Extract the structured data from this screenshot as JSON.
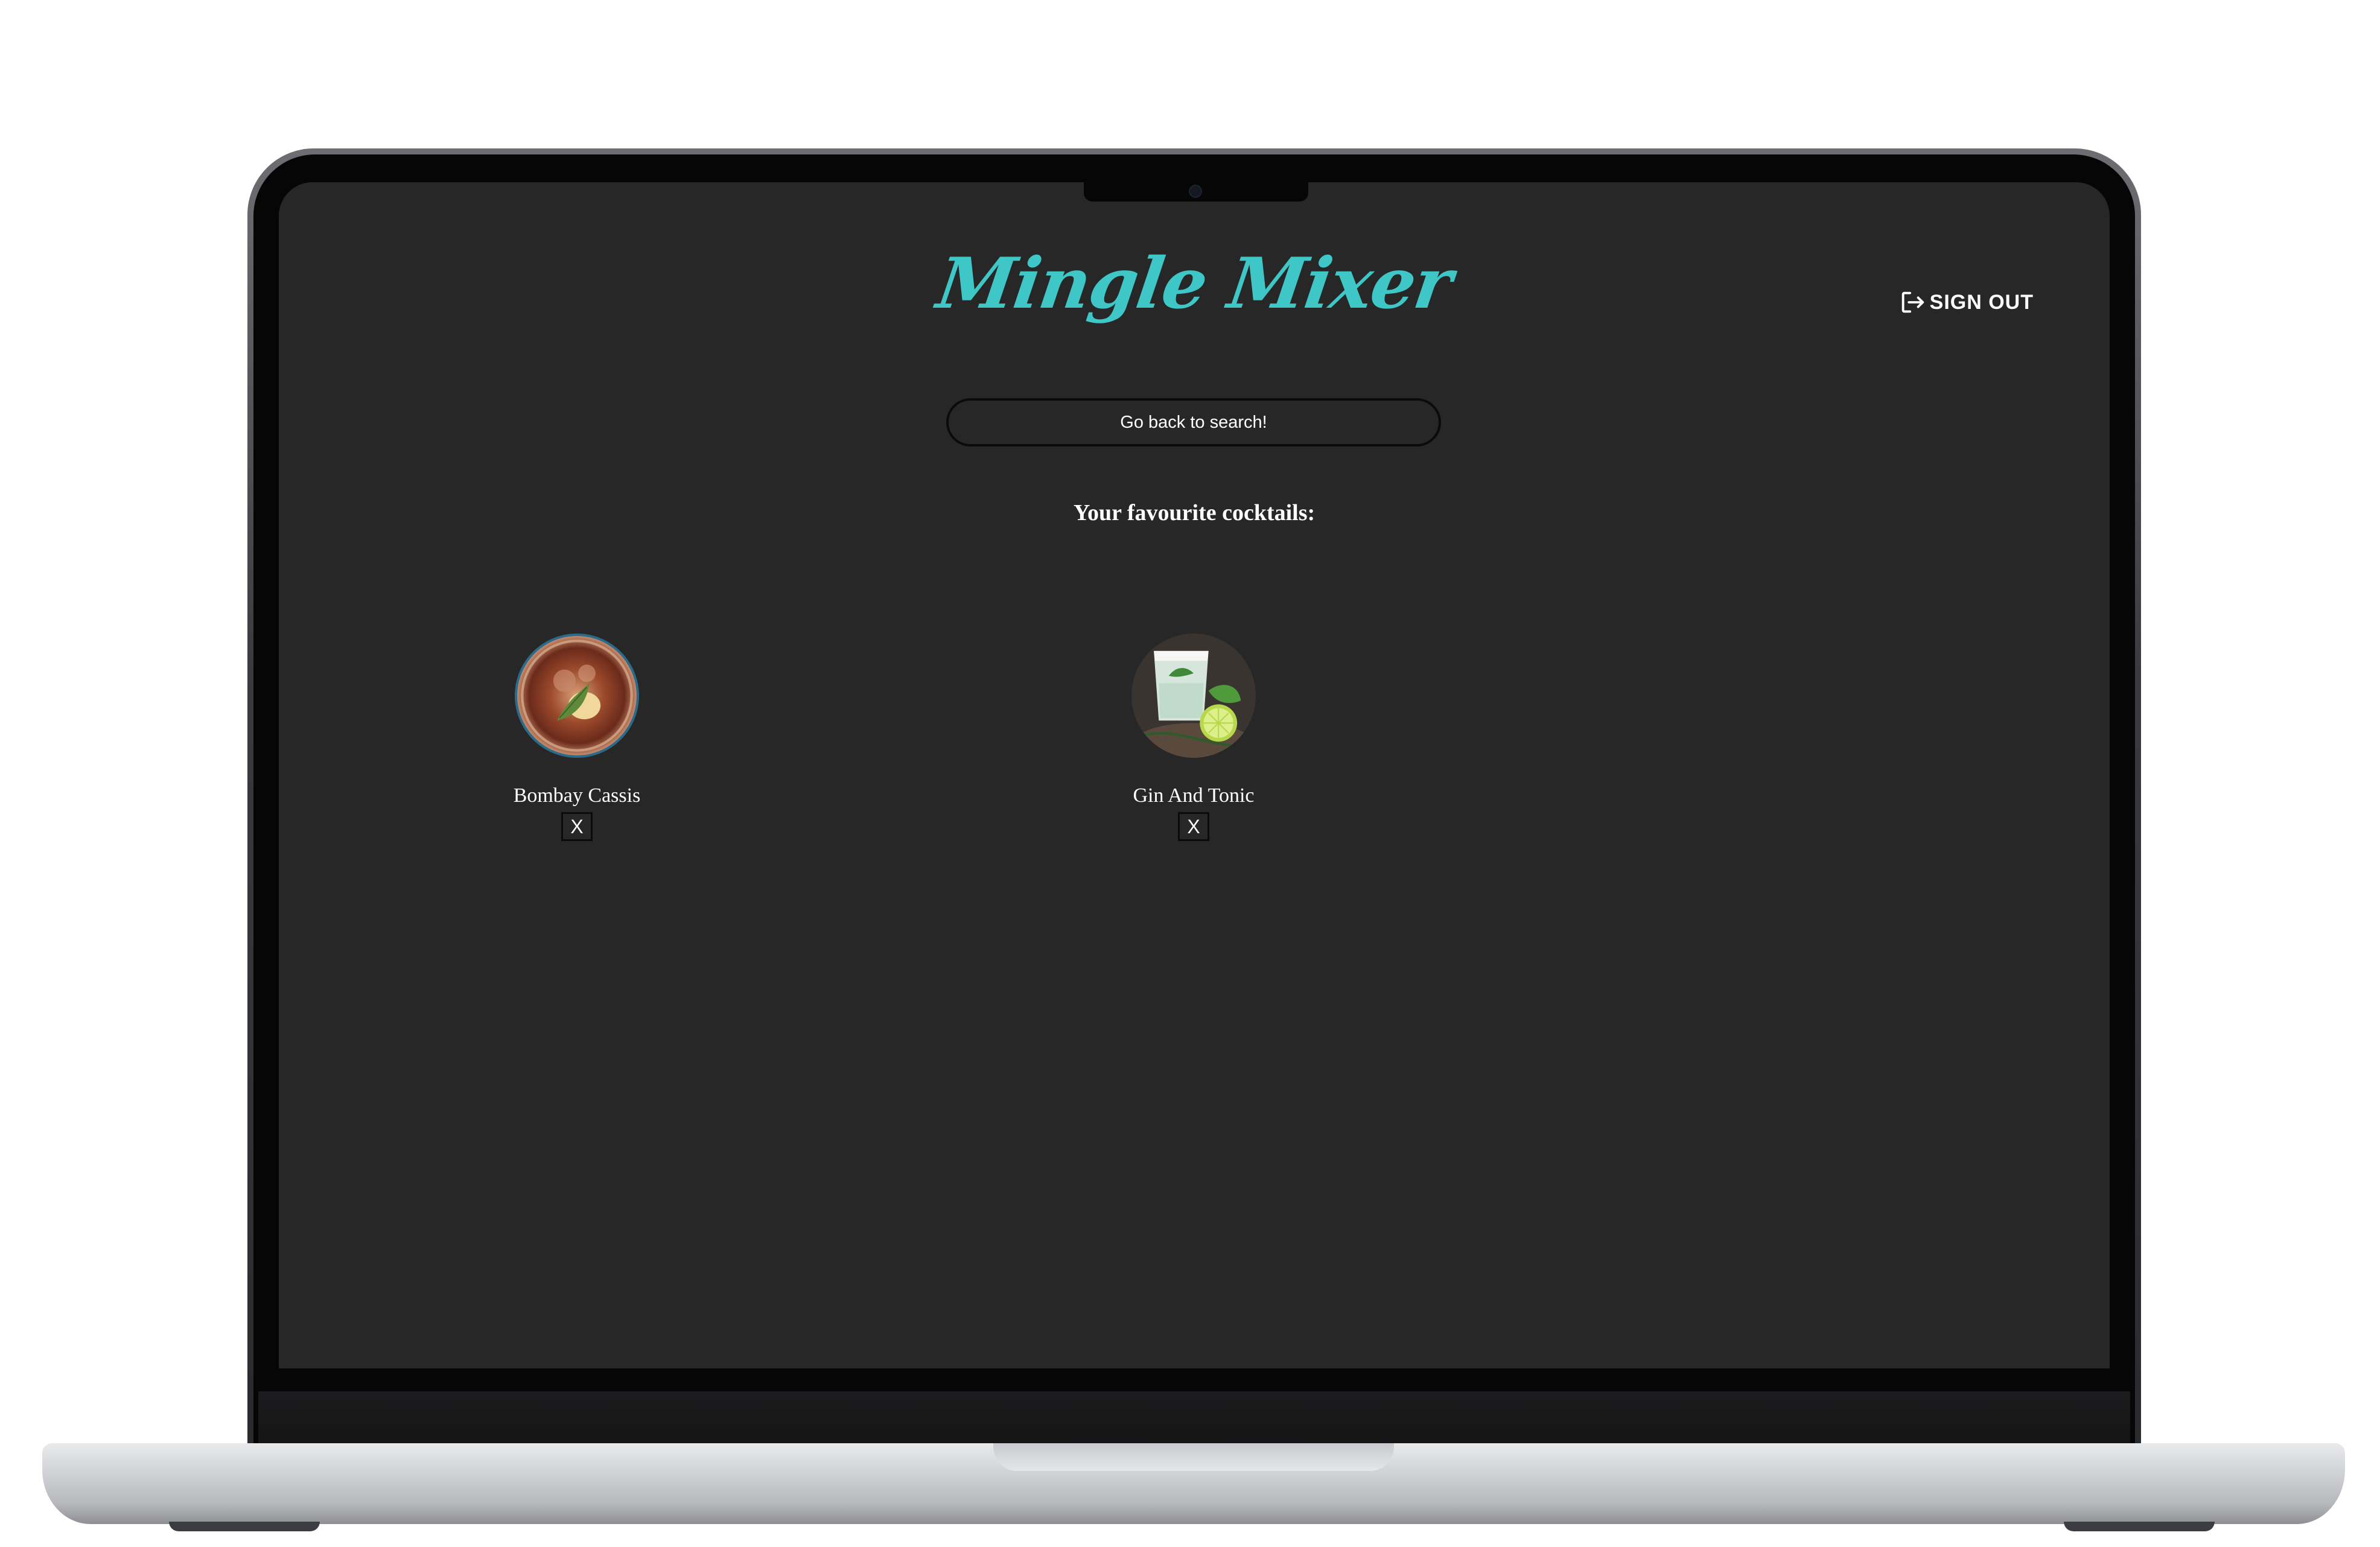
{
  "app": {
    "title": "Mingle Mixer",
    "signout_label": "SIGN OUT"
  },
  "search": {
    "back_label": "Go back to search!"
  },
  "favourites": {
    "heading": "Your favourite cocktails:",
    "items": [
      {
        "name": "Bombay Cassis",
        "remove_label": "X",
        "image": "cocktail-thumbnail"
      },
      {
        "name": "Gin And Tonic",
        "remove_label": "X",
        "image": "cocktail-thumbnail"
      }
    ]
  },
  "colors": {
    "background": "#272727",
    "brand": "#3fc6c6",
    "text": "#ffffff"
  },
  "icons": {
    "signout": "sign-out-icon"
  }
}
